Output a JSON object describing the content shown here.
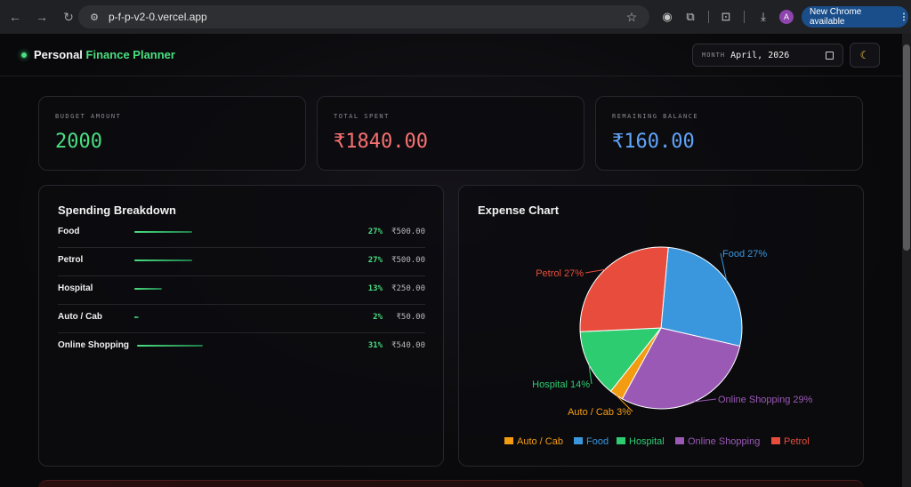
{
  "browser": {
    "url": "p-f-p-v2-0.vercel.app",
    "profile_initial": "A",
    "update_label": "New Chrome available"
  },
  "header": {
    "brand_primary": "Personal",
    "brand_accent": "Finance Planner",
    "month_label": "MONTH",
    "month_value": "April, 2026"
  },
  "stats": {
    "budget": {
      "label": "BUDGET AMOUNT",
      "value": "2000",
      "color": "#4ade80"
    },
    "spent": {
      "label": "TOTAL SPENT",
      "value": "₹1840.00",
      "color": "#f87171"
    },
    "remaining": {
      "label": "REMAINING BALANCE",
      "value": "₹160.00",
      "color": "#60a5fa"
    }
  },
  "breakdown": {
    "title": "Spending Breakdown",
    "items": [
      {
        "name": "Food",
        "percent": "27%",
        "amount": "₹500.00",
        "fill": 0.27
      },
      {
        "name": "Petrol",
        "percent": "27%",
        "amount": "₹500.00",
        "fill": 0.27
      },
      {
        "name": "Hospital",
        "percent": "13%",
        "amount": "₹250.00",
        "fill": 0.13
      },
      {
        "name": "Auto / Cab",
        "percent": "2%",
        "amount": "₹50.00",
        "fill": 0.02
      },
      {
        "name": "Online Shopping",
        "percent": "31%",
        "amount": "₹540.00",
        "fill": 0.31
      }
    ]
  },
  "chart_panel": {
    "title": "Expense Chart"
  },
  "chart_data": {
    "type": "pie",
    "title": "Expense Chart",
    "slices": [
      {
        "name": "Food",
        "value": 500,
        "label": "Food 27%",
        "color": "#3b97dd"
      },
      {
        "name": "Online Shopping",
        "value": 540,
        "label": "Online Shopping 29%",
        "color": "#9b59b6"
      },
      {
        "name": "Auto / Cab",
        "value": 50,
        "label": "Auto / Cab 3%",
        "color": "#f39c12"
      },
      {
        "name": "Hospital",
        "value": 250,
        "label": "Hospital 14%",
        "color": "#2ecc71"
      },
      {
        "name": "Petrol",
        "value": 500,
        "label": "Petrol 27%",
        "color": "#e74c3c"
      }
    ],
    "legend": [
      {
        "name": "Auto / Cab",
        "color": "#f39c12"
      },
      {
        "name": "Food",
        "color": "#3b97dd"
      },
      {
        "name": "Hospital",
        "color": "#2ecc71"
      },
      {
        "name": "Online Shopping",
        "color": "#9b59b6"
      },
      {
        "name": "Petrol",
        "color": "#e74c3c"
      }
    ],
    "legend_position": "bottom"
  }
}
